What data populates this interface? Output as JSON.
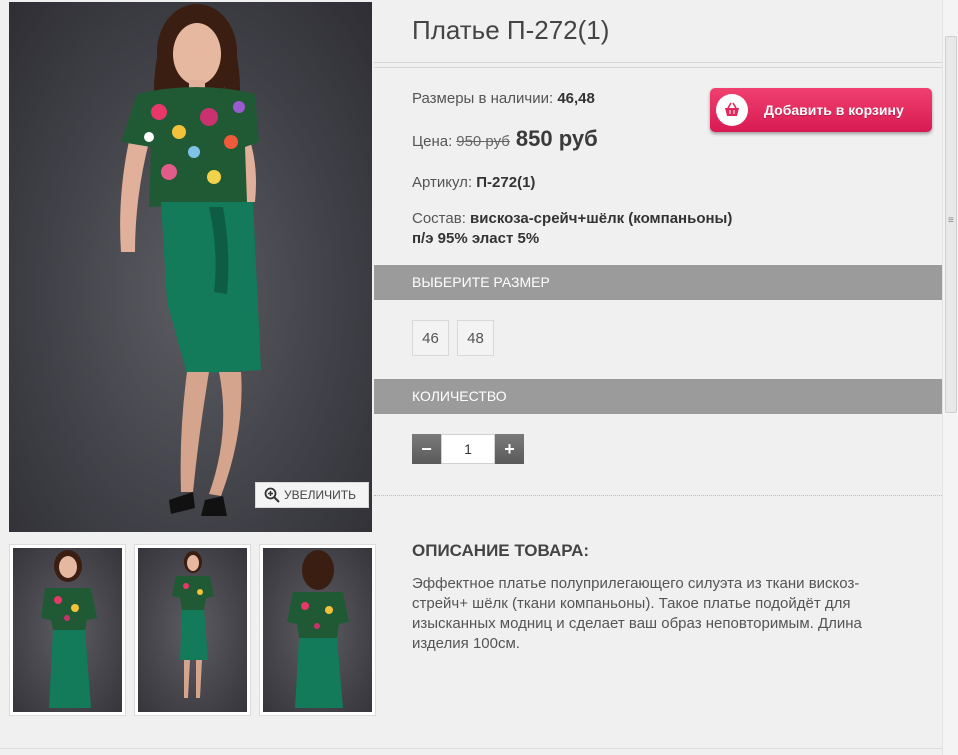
{
  "product": {
    "title": "Платье П-272(1)",
    "sizes_label": "Размеры в наличии:",
    "sizes_value": "46,48",
    "price_label": "Цена:",
    "price_old": "950 руб",
    "price_new": "850 руб",
    "sku_label": "Артикул:",
    "sku_value": "П-272(1)",
    "composition_label": "Состав:",
    "composition_value": "вискоза-срейч+шёлк (компаньоны) п/э 95% эласт 5%"
  },
  "actions": {
    "add_to_cart": "Добавить в корзину",
    "zoom": "УВЕЛИЧИТЬ"
  },
  "size_section": {
    "title": "ВЫБЕРИТЕ РАЗМЕР",
    "options": [
      "46",
      "48"
    ]
  },
  "quantity_section": {
    "title": "КОЛИЧЕСТВО",
    "minus": "−",
    "plus": "+",
    "value": "1"
  },
  "description": {
    "title": "ОПИСАНИЕ ТОВАРА:",
    "text": "Эффектное платье полуприлегающего силуэта из ткани вискоз-стрейч+ шёлк (ткани компаньоны). Такое платье подойдёт для изысканных модниц и сделает ваш образ неповторимым. Длина изделия 100см."
  },
  "colors": {
    "cart_button": "#e0285e",
    "section_bar": "#9b9b9b",
    "dress_green": "#137a5a"
  },
  "icons": {
    "zoom": "magnifier-plus-icon",
    "cart": "basket-icon"
  }
}
